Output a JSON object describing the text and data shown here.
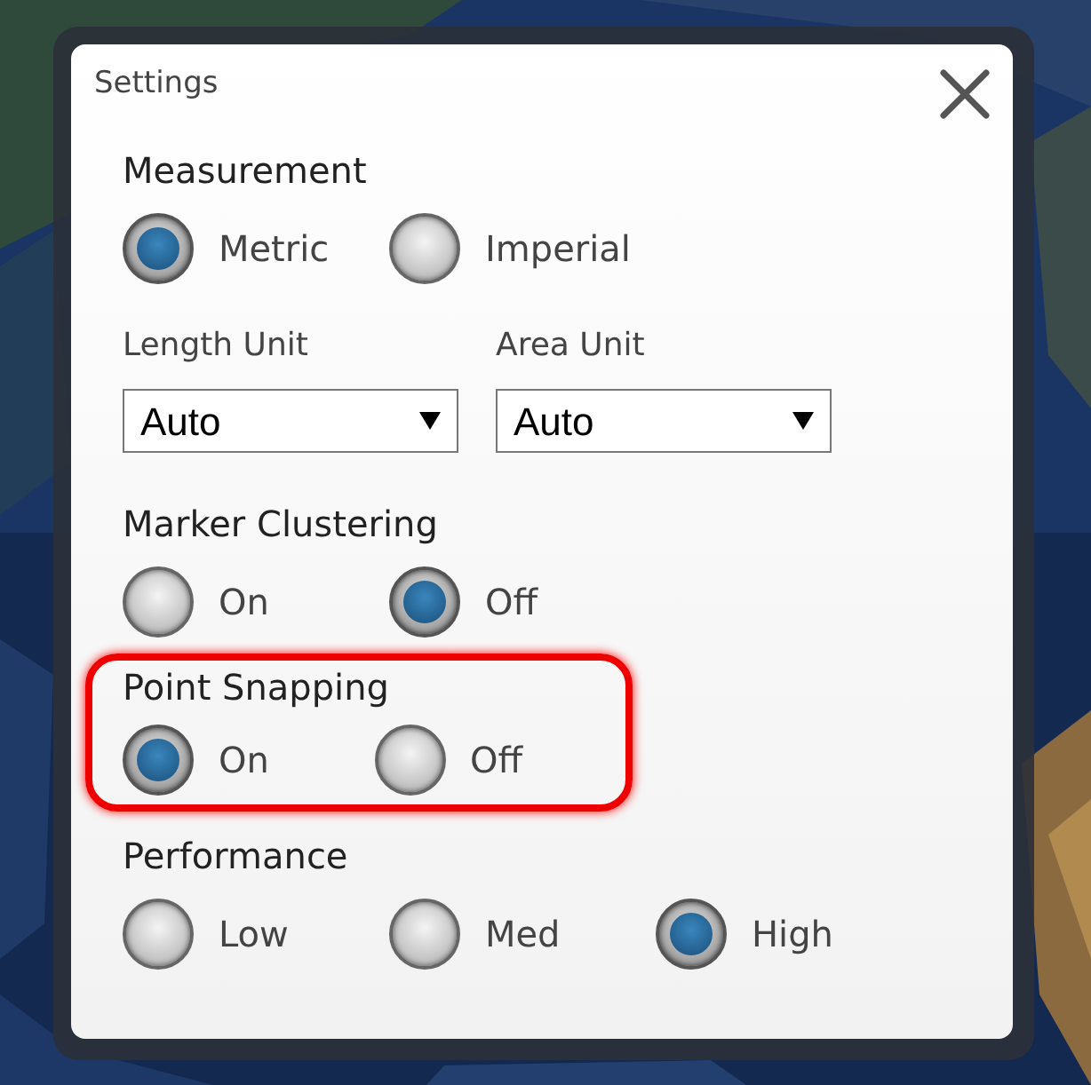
{
  "dialog": {
    "title": "Settings"
  },
  "sections": [
    {
      "title": "Measurement",
      "highlighted": false,
      "options": [
        {
          "label": "Metric",
          "selected": true
        },
        {
          "label": "Imperial",
          "selected": false
        }
      ],
      "selects": [
        {
          "label": "Length Unit",
          "value": "Auto"
        },
        {
          "label": "Area Unit",
          "value": "Auto"
        }
      ]
    },
    {
      "title": "Marker Clustering",
      "highlighted": false,
      "options": [
        {
          "label": "On",
          "selected": false
        },
        {
          "label": "Off",
          "selected": true
        }
      ]
    },
    {
      "title": "Point Snapping",
      "highlighted": true,
      "options": [
        {
          "label": "On",
          "selected": true
        },
        {
          "label": "Off",
          "selected": false
        }
      ]
    },
    {
      "title": "Performance",
      "highlighted": false,
      "options": [
        {
          "label": "Low",
          "selected": false
        },
        {
          "label": "Med",
          "selected": false
        },
        {
          "label": "High",
          "selected": true
        }
      ]
    }
  ]
}
